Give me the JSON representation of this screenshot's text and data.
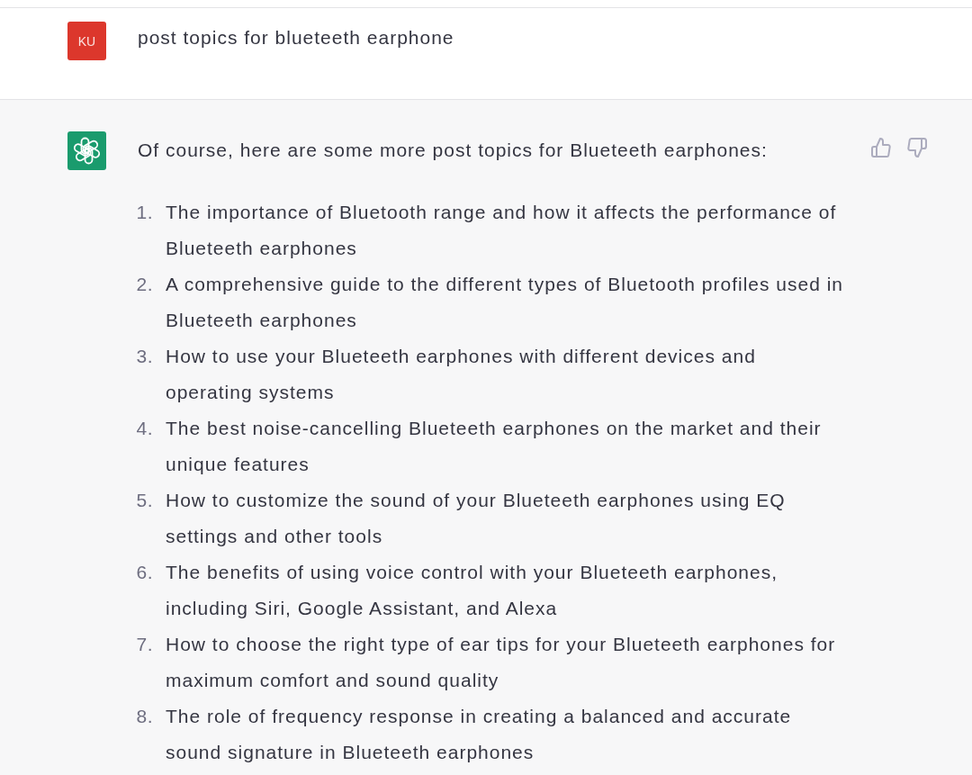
{
  "user_message": {
    "avatar_initials": "KU",
    "text": "post topics for blueteeth earphone"
  },
  "assistant_message": {
    "intro": "Of course, here are some more post topics for Blueteeth earphones:",
    "items": [
      {
        "number": "1.",
        "text": "The importance of Bluetooth range and how it affects the performance of Blueteeth earphones"
      },
      {
        "number": "2.",
        "text": "A comprehensive guide to the different types of Bluetooth profiles used in Blueteeth earphones"
      },
      {
        "number": "3.",
        "text": "How to use your Blueteeth earphones with different devices and operating systems"
      },
      {
        "number": "4.",
        "text": "The best noise-cancelling Blueteeth earphones on the market and their unique features"
      },
      {
        "number": "5.",
        "text": "How to customize the sound of your Blueteeth earphones using EQ settings and other tools"
      },
      {
        "number": "6.",
        "text": "The benefits of using voice control with your Blueteeth earphones, including Siri, Google Assistant, and Alexa"
      },
      {
        "number": "7.",
        "text": "How to choose the right type of ear tips for your Blueteeth earphones for maximum comfort and sound quality"
      },
      {
        "number": "8.",
        "text": "The role of frequency response in creating a balanced and accurate sound signature in Blueteeth earphones"
      }
    ]
  }
}
